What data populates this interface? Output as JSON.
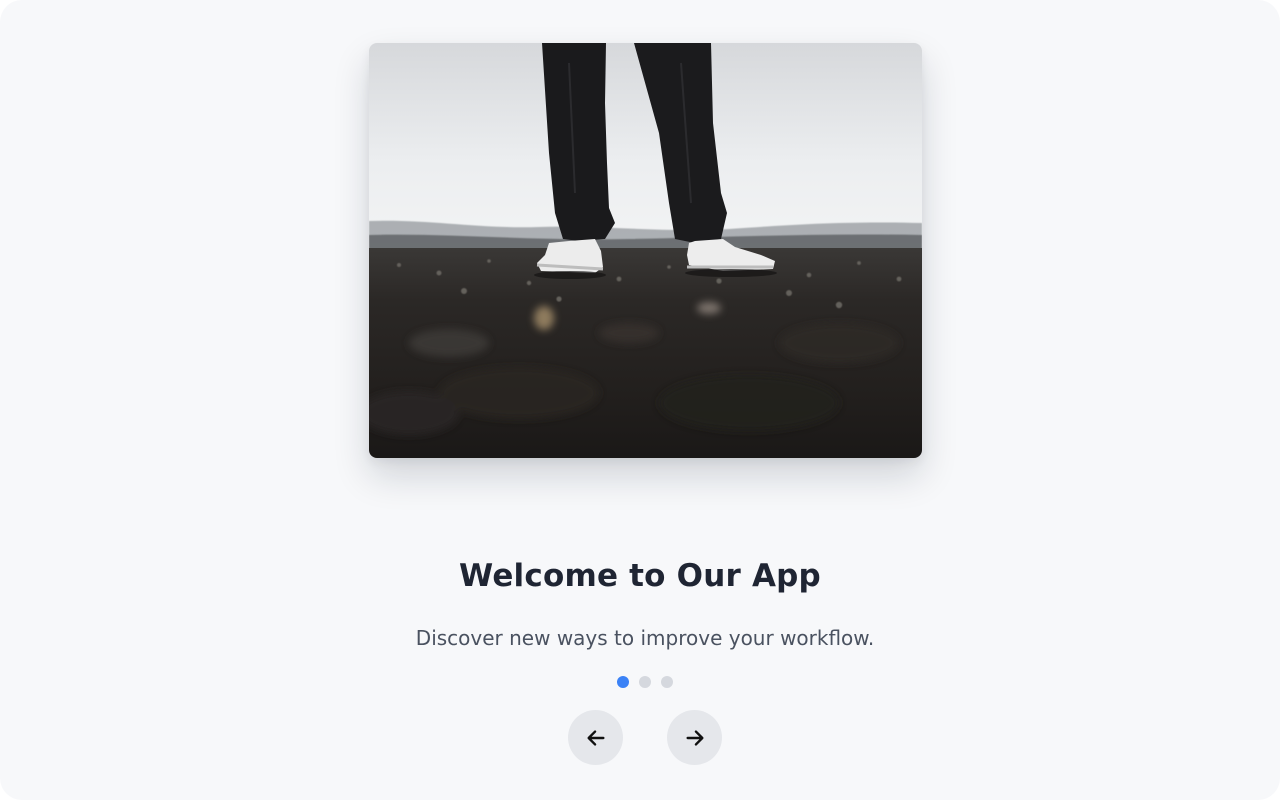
{
  "onboarding": {
    "title": "Welcome to Our App",
    "subtitle": "Discover new ways to improve your workflow.",
    "current_slide": 1,
    "slide_count": 3
  },
  "hero_image": {
    "description_icon": "photo-sneakers-on-gravel"
  },
  "navigation": {
    "prev_icon": "arrow-left-icon",
    "next_icon": "arrow-right-icon"
  },
  "colors": {
    "background": "#f7f8fa",
    "accent": "#3b82f6",
    "dot_inactive": "#d5d8de",
    "button_bg": "#e5e7eb",
    "title_text": "#1f2533",
    "subtitle_text": "#4a5260"
  }
}
